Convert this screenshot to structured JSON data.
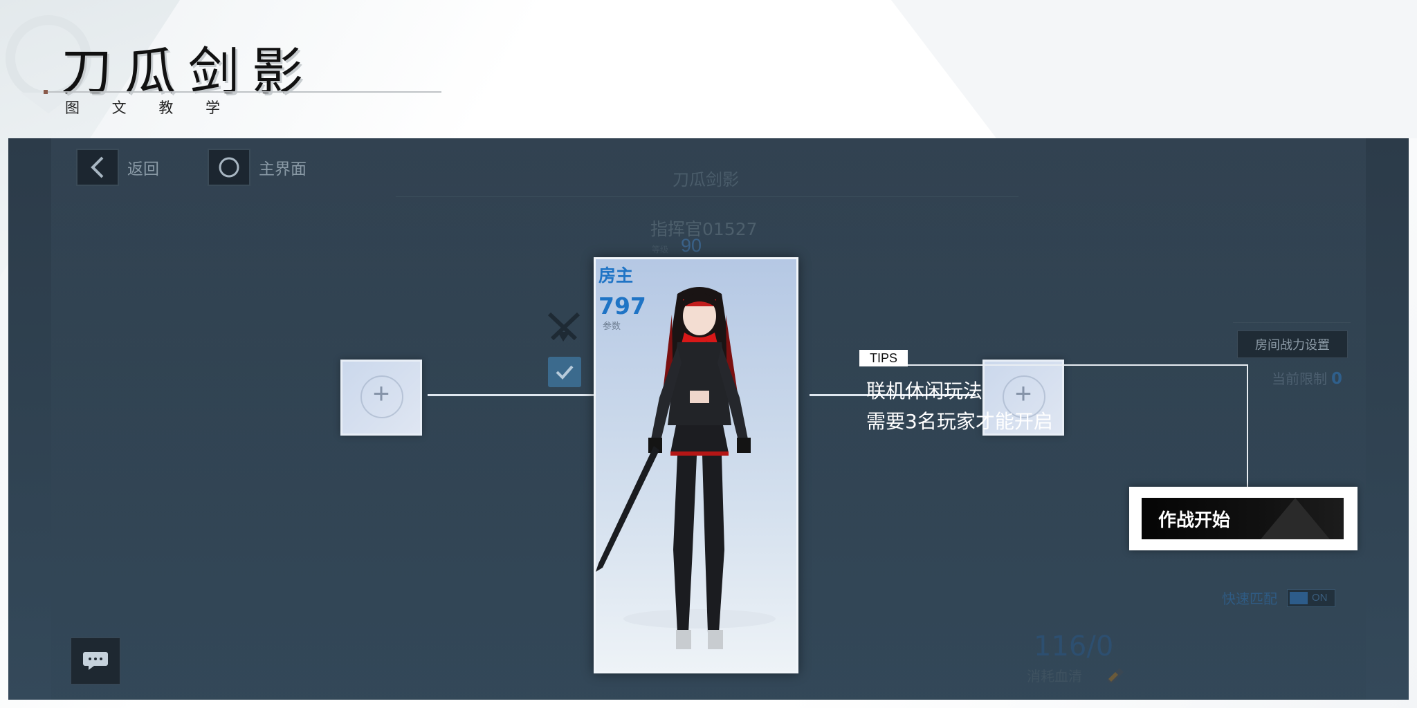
{
  "header": {
    "title": "刀瓜剑影",
    "subtitle": "图 文 教 学"
  },
  "game": {
    "nav": {
      "back_label": "返回",
      "home_label": "主界面"
    },
    "mode_title": "刀瓜剑影",
    "commander_name": "指挥官01527",
    "level_label": "等级",
    "level_value": "90",
    "host_label": "房主",
    "power_value": "797",
    "power_sub": "参数",
    "room_power_button": "房间战力设置",
    "current_limit_label": "当前限制",
    "current_limit_value": "0",
    "quick_match_label": "快速匹配",
    "quick_match_toggle": "ON",
    "cost_value": "116/0",
    "cost_label": "消耗血清",
    "slots": [
      {
        "label": "+"
      },
      {
        "label": "+"
      }
    ],
    "start_button": "作战开始"
  },
  "tips": {
    "tag": "TIPS",
    "line1": "联机休闲玩法",
    "line2": "需要3名玩家才能开启"
  },
  "colors": {
    "accent_blue": "#1f74c5",
    "game_bg": "#2f4150",
    "start_bg": "#0a0a0a"
  }
}
